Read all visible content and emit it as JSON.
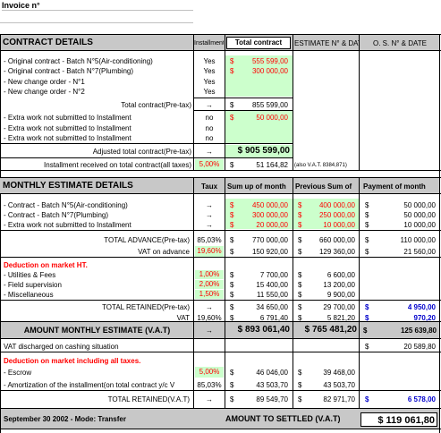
{
  "invoice_label": "Invoice n°",
  "contract": {
    "title": "CONTRACT DETAILS",
    "col_install": "Installment",
    "col_total": "Total contract",
    "col_estimate": "ESTIMATE N° & DATE",
    "col_os": "O. S. N° & DATE",
    "rows": [
      {
        "label": "- Original contract - Batch N°5(Air-conditioning)",
        "inst": "Yes",
        "cur": "$",
        "amt": "555 599,00",
        "red": true
      },
      {
        "label": "- Original contract - Batch N°7(Plumbing)",
        "inst": "Yes",
        "cur": "$",
        "amt": "300 000,00",
        "red": true
      },
      {
        "label": "- New change order - N°1",
        "inst": "Yes",
        "cur": "",
        "amt": "",
        "red": false
      },
      {
        "label": "- New change order - N°2",
        "inst": "Yes",
        "cur": "",
        "amt": "",
        "red": false
      }
    ],
    "total_pretax_label": "Total contract(Pre-tax)",
    "total_pretax_arrow": "→",
    "total_pretax_cur": "$",
    "total_pretax_amt": "855 599,00",
    "extra_rows": [
      {
        "label": "- Extra work not submitted to Installment",
        "inst": "no",
        "cur": "$",
        "amt": "50 000,00",
        "red": true
      },
      {
        "label": "- Extra work not submitted to Installment",
        "inst": "no",
        "cur": "",
        "amt": "",
        "red": false
      },
      {
        "label": "- Extra work not submitted to Installment",
        "inst": "no",
        "cur": "",
        "amt": "",
        "red": false
      }
    ],
    "adjusted_label": "Adjusted total contract(Pre-tax)",
    "adjusted_arrow": "→",
    "adjusted_amt": "$ 905 599,00",
    "installment_label": "Installment received on total contract(all taxes)",
    "installment_pct": "5,00%",
    "installment_cur": "$",
    "installment_amt": "51 164,82",
    "installment_note": "(also V.A.T. 8384,871)"
  },
  "monthly": {
    "title": "MONTHLY ESTIMATE DETAILS",
    "col_rate": "Taux",
    "col_sumup": "Sum up of month",
    "col_prev": "Previous Sum of",
    "col_payment": "Payment of month",
    "rows": [
      {
        "label": "- Contract - Batch N°5(Air-conditioning)",
        "rate": "→",
        "c1": "$",
        "v1": "450 000,00",
        "c2": "$",
        "v2": "400 000,00",
        "c3": "$",
        "v3": "50 000,00"
      },
      {
        "label": "- Contract - Batch N°7(Plumbing)",
        "rate": "→",
        "c1": "$",
        "v1": "300 000,00",
        "c2": "$",
        "v2": "250 000,00",
        "c3": "$",
        "v3": "50 000,00"
      },
      {
        "label": "- Extra work not submitted to Installment",
        "rate": "→",
        "c1": "$",
        "v1": "20 000,00",
        "c2": "$",
        "v2": "10 000,00",
        "c3": "$",
        "v3": "10 000,00"
      }
    ],
    "total_advance": {
      "label": "TOTAL ADVANCE(Pre-tax)",
      "rate": "85,03%",
      "c1": "$",
      "v1": "770 000,00",
      "c2": "$",
      "v2": "660 000,00",
      "c3": "$",
      "v3": "110 000,00"
    },
    "vat_advance": {
      "label": "VAT on advance",
      "rate": "19,60%",
      "c1": "$",
      "v1": "150 920,00",
      "c2": "$",
      "v2": "129 360,00",
      "c3": "$",
      "v3": "21 560,00"
    },
    "deduction_ht_title": "Deduction on market HT.",
    "deduction_rows": [
      {
        "label": "- Utilities & Fees",
        "rate": "1,00%",
        "c1": "$",
        "v1": "7 700,00",
        "c2": "$",
        "v2": "6 600,00"
      },
      {
        "label": "- Field supervision",
        "rate": "2,00%",
        "c1": "$",
        "v1": "15 400,00",
        "c2": "$",
        "v2": "13 200,00"
      },
      {
        "label": "- Miscellaneous",
        "rate": "1,50%",
        "c1": "$",
        "v1": "11 550,00",
        "c2": "$",
        "v2": "9 900,00"
      }
    ],
    "total_retained_pretax": {
      "label": "TOTAL RETAINED(Pre-tax)",
      "rate": "→",
      "c1": "$",
      "v1": "34 650,00",
      "c2": "$",
      "v2": "29 700,00",
      "c3": "$",
      "v3": "4 950,00"
    },
    "vat_row": {
      "label": "VAT",
      "rate": "19,60%",
      "c1": "$",
      "v1": "6 791,40",
      "c2": "$",
      "v2": "5 821,20",
      "c3": "$",
      "v3": "970,20"
    },
    "amount_monthly": {
      "label": "AMOUNT MONTHLY ESTIMATE (V.A.T)",
      "rate": "→",
      "v1": "$ 893 061,40",
      "v2": "$ 765 481,20",
      "c3": "$",
      "v3": "125 639,80"
    },
    "vat_discharged": {
      "label": "VAT discharged on cashing situation",
      "c3": "$",
      "v3": "20 589,80"
    },
    "deduction_all_title": "Deduction on market including all taxes.",
    "escrow": {
      "label": "- Escrow",
      "rate": "5,00%",
      "c1": "$",
      "v1": "46 046,00",
      "c2": "$",
      "v2": "39 468,00"
    },
    "amortization": {
      "label": "- Amortization of the installment(on total contract y/c V",
      "rate": "85,03%",
      "c1": "$",
      "v1": "43 503,70",
      "c2": "$",
      "v2": "43 503,70"
    },
    "total_retained_vat": {
      "label": "TOTAL RETAINED(V.A.T)",
      "rate": "→",
      "c1": "$",
      "v1": "89 549,70",
      "c2": "$",
      "v2": "82 971,70",
      "c3": "$",
      "v3": "6 578,00"
    }
  },
  "footer": {
    "date_mode": "September 30 2002 - Mode: Transfer",
    "settle_label": "AMOUNT TO SETTLED (V.A.T)",
    "settle_amt": "$ 119 061,80"
  }
}
